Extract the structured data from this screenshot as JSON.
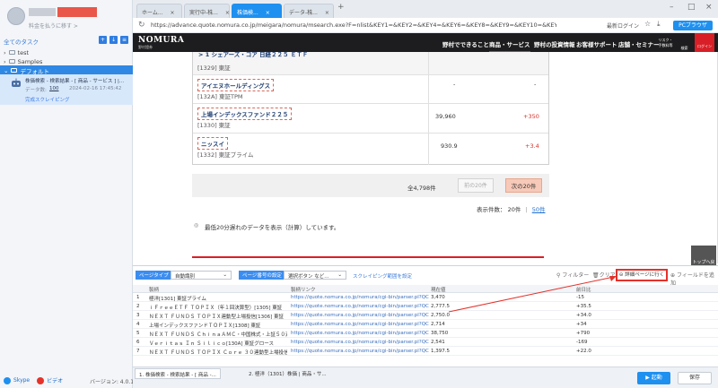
{
  "left": {
    "profile_sub": "料金を払うに移す >",
    "tasks_title": "全てのタスク",
    "tree": [
      {
        "label": "test"
      },
      {
        "label": "Samples"
      },
      {
        "label": "デフォルト"
      }
    ],
    "task": {
      "name": "株価検索 - 検索結果 - [ 商品 - サービス ] |...",
      "meta_label": "データ数:",
      "count": "100",
      "date": "2024-02-16 17:45:42",
      "status": "完成スクレイピング"
    },
    "skype": "Skype",
    "youtube": "ビデオ",
    "version": "バージョン: 4.0.1"
  },
  "tabs": [
    "ホーム...",
    "実行中-株...",
    "株価検...",
    "データ-株..."
  ],
  "url": "https://advance.quote.nomura.co.jp/meigara/nomura/msearch.exe?F=nlist&KEY1=&KEY2=&KEY4=&KEY6=&KEY8=&KEY9=&KEY10=&KEY11=&KEY12=&KE",
  "url_right": {
    "login": "最新ログイン",
    "pc": "PCブラウザ"
  },
  "site": {
    "logo": "NOMURA",
    "logo_sub": "野村證券",
    "nav": [
      "野村でできること",
      "商品・サービス",
      "野村の投資情報",
      "お客様サポート",
      "店舗・セミナー"
    ],
    "fee": "リスク・手数料等",
    "search": "検索",
    "login": "ログイン",
    "top_row": "> 1 シェアーズ・コア  日経２２５ ＥＴＦ",
    "rows": [
      {
        "code": "[1329] 東証",
        "price": "",
        "change": ""
      },
      {
        "name": "アイエヌホールディングス",
        "code": "[132A] 東証TPM",
        "price": "-",
        "change": "-"
      },
      {
        "name": "上場インデックスファンド２２５",
        "code": "[1330] 東証",
        "price": "39,960",
        "change": "+350"
      },
      {
        "name": "ニッスイ",
        "code": "[1332] 東証プライム",
        "price": "930.9",
        "change": "+3.4"
      }
    ],
    "total": "全4,798件",
    "prev": "前の20件",
    "next": "次の20件",
    "per_label": "表示件数：",
    "per_20": "20件",
    "per_50": "50件",
    "note": "最低20分遅れのデータを表示（計算）しています。",
    "top_btn": "トップへ戻る"
  },
  "panel": {
    "page_type_label": "ページタイプ",
    "page_type_value": "自動識別",
    "pager_label": "ページ番号の設定",
    "pager_value": "選択ボタン など...",
    "range_link": "スクレイピング範囲を設定",
    "filter": "フィルター",
    "clear": "クリア",
    "detail": "詳細ページに行く",
    "add_field": "フィールドを追加",
    "columns": [
      "",
      "製柄",
      "製柄リンク",
      "現在値",
      "前日比"
    ],
    "rows": [
      [
        "1",
        "極洋[1301] 東証プライム",
        "https://quote.nomura.co.jp/nomura/cgi-bin/parser.pl?QCODE=1301...",
        "3,470",
        "-15"
      ],
      [
        "2",
        "ｉＦｒｅｅＥＴＦ ＴＯＰＩＸ（年１回決算型）[1305] 東証",
        "https://quote.nomura.co.jp/nomura/cgi-bin/parser.pl?QCODE=1305...",
        "2,777.5",
        "+35.5"
      ],
      [
        "3",
        "ＮＥＸＴ ＦＵＮＤＳ ＴＯＰＩＸ連動型上場投信[1306] 東証",
        "https://quote.nomura.co.jp/nomura/cgi-bin/parser.pl?QCODE=1306...",
        "2,750.0",
        "+34.0"
      ],
      [
        "4",
        "上場インデックスファンドＴＯＰＩＸ[1308] 東証",
        "https://quote.nomura.co.jp/nomura/cgi-bin/parser.pl?QCODE=1308...",
        "2,714",
        "+34"
      ],
      [
        "5",
        "ＮＥＸＴ ＦＵＮＤＳ ＣｈｉｎａＡＭＣ・中国株式・上証５０連動型...",
        "https://quote.nomura.co.jp/nomura/cgi-bin/parser.pl?QCODE=1309...",
        "38,750",
        "+790"
      ],
      [
        "6",
        "Ｖｅｒｉｔａｓ Ｉｎ Ｓｉｌｉｃｏ[130A] 東証グロース",
        "https://quote.nomura.co.jp/nomura/cgi-bin/parser.pl?QCODE=130A...",
        "2,541",
        "-169"
      ],
      [
        "7",
        "ＮＥＸＴ ＦＵＮＤＳ ＴＯＰＩＸ Ｃｏｒｅ ３０連動型上場投信...",
        "https://quote.nomura.co.jp/nomura/cgi-bin/parser.pl?QCODE=1311...",
        "1,397.5",
        "+22.0"
      ]
    ]
  },
  "bottom": {
    "tab1": "1. 株価検索 - 検索結果 - [ 商品 -...",
    "tab2": "2. 極洋（1301）株価 | 商品・サ...",
    "start": "起動",
    "save": "保存"
  }
}
